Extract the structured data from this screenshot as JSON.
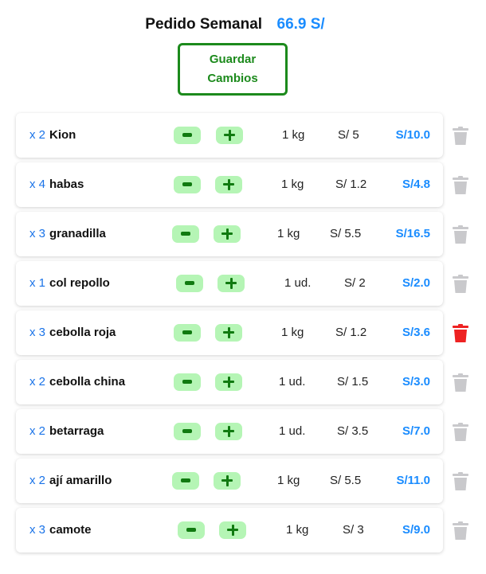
{
  "header": {
    "title": "Pedido Semanal",
    "total": "66.9 S/"
  },
  "save_button": {
    "line1": "Guardar",
    "line2": "Cambios"
  },
  "colors": {
    "accent": "#1a8cff",
    "qty": "#1a73e8",
    "save_green": "#1c8a1c",
    "stepper_bg": "#b5f5b5",
    "trash_default": "#c9c9cc",
    "trash_active": "#ee2222"
  },
  "items": [
    {
      "qty": "x 2",
      "name": "Kion",
      "unit": "1 kg",
      "price": "S/ 5",
      "subtotal": "S/10.0",
      "trash_active": false
    },
    {
      "qty": "x 4",
      "name": "habas",
      "unit": "1 kg",
      "price": "S/ 1.2",
      "subtotal": "S/4.8",
      "trash_active": false
    },
    {
      "qty": "x 3",
      "name": "granadilla",
      "unit": "1 kg",
      "price": "S/ 5.5",
      "subtotal": "S/16.5",
      "trash_active": false
    },
    {
      "qty": "x 1",
      "name": "col repollo",
      "unit": "1 ud.",
      "price": "S/ 2",
      "subtotal": "S/2.0",
      "trash_active": false
    },
    {
      "qty": "x 3",
      "name": "cebolla roja",
      "unit": "1 kg",
      "price": "S/ 1.2",
      "subtotal": "S/3.6",
      "trash_active": true
    },
    {
      "qty": "x 2",
      "name": "cebolla china",
      "unit": "1 ud.",
      "price": "S/ 1.5",
      "subtotal": "S/3.0",
      "trash_active": false
    },
    {
      "qty": "x 2",
      "name": "betarraga",
      "unit": "1 ud.",
      "price": "S/ 3.5",
      "subtotal": "S/7.0",
      "trash_active": false
    },
    {
      "qty": "x 2",
      "name": "ají amarillo",
      "unit": "1 kg",
      "price": "S/ 5.5",
      "subtotal": "S/11.0",
      "trash_active": false
    },
    {
      "qty": "x 3",
      "name": "camote",
      "unit": "1 kg",
      "price": "S/ 3",
      "subtotal": "S/9.0",
      "trash_active": false
    }
  ]
}
